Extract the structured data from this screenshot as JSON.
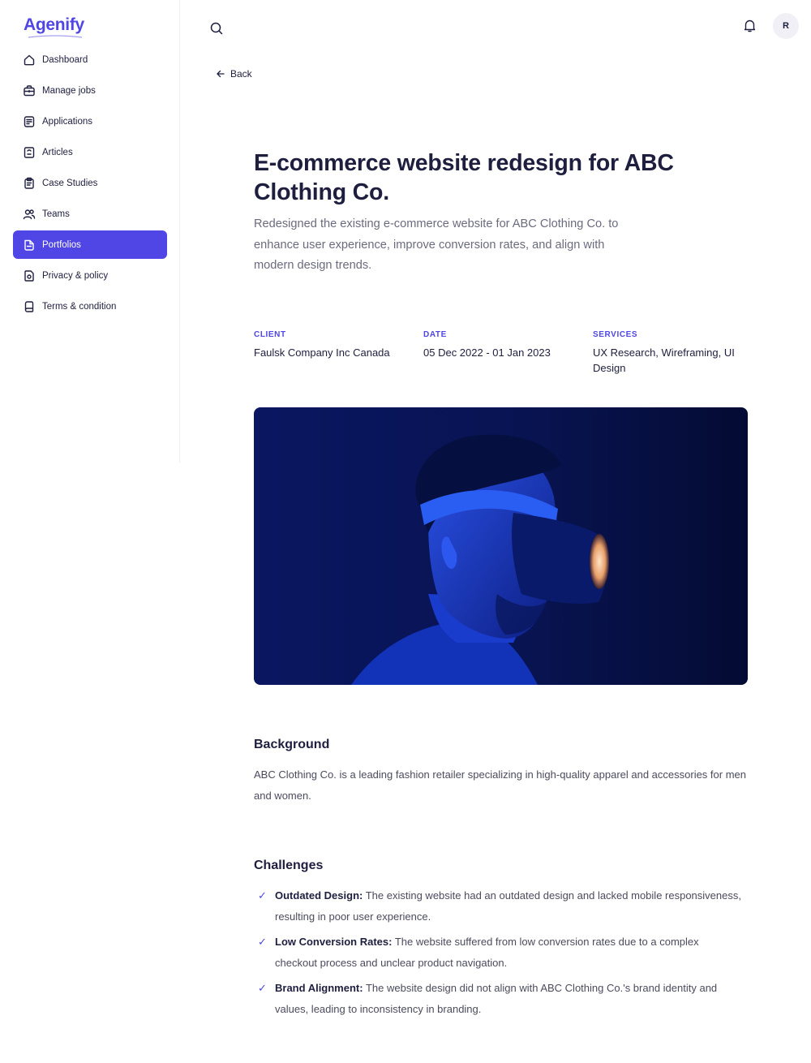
{
  "app": {
    "logo": "Agenify"
  },
  "sidebar": {
    "items": [
      {
        "label": "Dashboard",
        "icon": "dashboard-icon",
        "active": false
      },
      {
        "label": "Manage jobs",
        "icon": "briefcase-icon",
        "active": false
      },
      {
        "label": "Applications",
        "icon": "applications-icon",
        "active": false
      },
      {
        "label": "Articles",
        "icon": "articles-icon",
        "active": false
      },
      {
        "label": "Case Studies",
        "icon": "clipboard-icon",
        "active": false
      },
      {
        "label": "Teams",
        "icon": "users-icon",
        "active": false
      },
      {
        "label": "Portfolios",
        "icon": "portfolio-icon",
        "active": true
      },
      {
        "label": "Privacy & policy",
        "icon": "privacy-icon",
        "active": false
      },
      {
        "label": "Terms & condition",
        "icon": "terms-icon",
        "active": false
      }
    ]
  },
  "header": {
    "avatar_initial": "R",
    "back_label": "Back"
  },
  "main": {
    "title": "E-commerce website redesign for ABC Clothing Co.",
    "subtitle": "Redesigned the existing e-commerce website for ABC Clothing Co. to enhance user experience, improve conversion rates, and align with modern design trends.",
    "meta": {
      "client_label": "CLIENT",
      "client_value": "Faulsk Company Inc Canada",
      "date_label": "DATE",
      "date_value": "05 Dec 2022 - 01 Jan 2023",
      "services_label": "SERVICES",
      "services_value": "UX Research, Wireframing, UI Design"
    },
    "background_title": "Background",
    "background_text": "ABC Clothing Co. is a leading fashion retailer specializing in high-quality apparel and accessories for men and women.",
    "challenges_title": "Challenges",
    "challenges": [
      {
        "title": "Outdated Design:",
        "text": "The existing website had an outdated design and lacked mobile responsiveness, resulting in poor user experience."
      },
      {
        "title": "Low Conversion Rates:",
        "text": "The website suffered from low conversion rates due to a complex checkout process and unclear product navigation."
      },
      {
        "title": "Brand Alignment:",
        "text": "The website design did not align with ABC Clothing Co.'s brand identity and values, leading to inconsistency in branding."
      }
    ],
    "check_glyph": "✓"
  },
  "colors": {
    "accent": "#4f46e5",
    "text": "#1e1e3f",
    "muted": "#6b6b7e"
  }
}
